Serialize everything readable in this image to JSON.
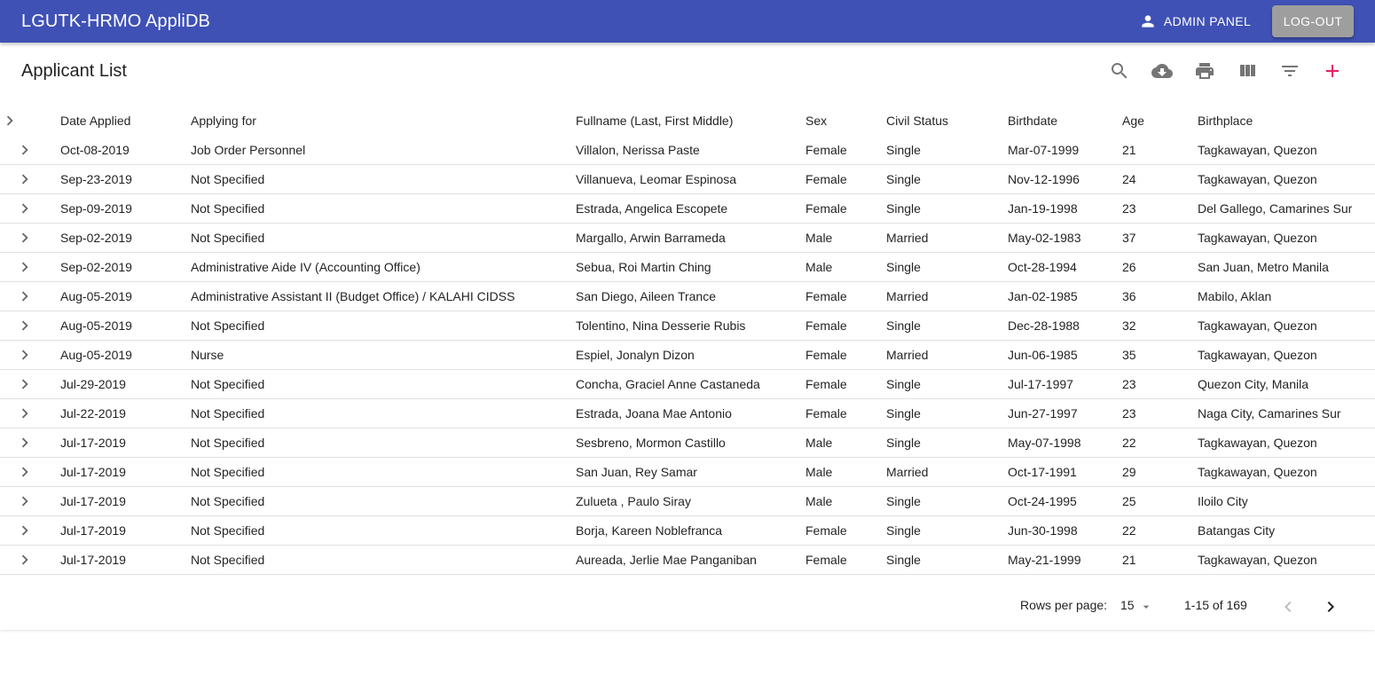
{
  "appbar": {
    "title": "LGUTK-HRMO AppliDB",
    "admin_label": "ADMIN PANEL",
    "logout_label": "LOG-OUT",
    "color": "#3f51b5"
  },
  "list": {
    "title": "Applicant List",
    "toolbar_icons": [
      "search-icon",
      "cloud-download-icon",
      "print-icon",
      "view-column-icon",
      "filter-list-icon",
      "add-icon"
    ],
    "add_color": "#e91e63"
  },
  "table": {
    "columns": [
      "Date Applied",
      "Applying for",
      "Fullname (Last, First Middle)",
      "Sex",
      "Civil Status",
      "Birthdate",
      "Age",
      "Birthplace"
    ],
    "rows": [
      [
        "Oct-08-2019",
        "Job Order Personnel",
        "Villalon, Nerissa Paste",
        "Female",
        "Single",
        "Mar-07-1999",
        "21",
        "Tagkawayan, Quezon"
      ],
      [
        "Sep-23-2019",
        "Not Specified",
        "Villanueva, Leomar Espinosa",
        "Female",
        "Single",
        "Nov-12-1996",
        "24",
        "Tagkawayan, Quezon"
      ],
      [
        "Sep-09-2019",
        "Not Specified",
        "Estrada, Angelica Escopete",
        "Female",
        "Single",
        "Jan-19-1998",
        "23",
        "Del Gallego, Camarines Sur"
      ],
      [
        "Sep-02-2019",
        "Not Specified",
        "Margallo, Arwin Barrameda",
        "Male",
        "Married",
        "May-02-1983",
        "37",
        "Tagkawayan, Quezon"
      ],
      [
        "Sep-02-2019",
        "Administrative Aide IV (Accounting Office)",
        "Sebua, Roi Martin Ching",
        "Male",
        "Single",
        "Oct-28-1994",
        "26",
        "San Juan, Metro Manila"
      ],
      [
        "Aug-05-2019",
        "Administrative Assistant II (Budget Office) / KALAHI CIDSS",
        "San Diego, Aileen Trance",
        "Female",
        "Married",
        "Jan-02-1985",
        "36",
        "Mabilo, Aklan"
      ],
      [
        "Aug-05-2019",
        "Not Specified",
        "Tolentino, Nina Desserie Rubis",
        "Female",
        "Single",
        "Dec-28-1988",
        "32",
        "Tagkawayan, Quezon"
      ],
      [
        "Aug-05-2019",
        "Nurse",
        "Espiel, Jonalyn Dizon",
        "Female",
        "Married",
        "Jun-06-1985",
        "35",
        "Tagkawayan, Quezon"
      ],
      [
        "Jul-29-2019",
        "Not Specified",
        "Concha, Graciel Anne Castaneda",
        "Female",
        "Single",
        "Jul-17-1997",
        "23",
        "Quezon City, Manila"
      ],
      [
        "Jul-22-2019",
        "Not Specified",
        "Estrada, Joana Mae Antonio",
        "Female",
        "Single",
        "Jun-27-1997",
        "23",
        "Naga City, Camarines Sur"
      ],
      [
        "Jul-17-2019",
        "Not Specified",
        "Sesbreno, Mormon Castillo",
        "Male",
        "Single",
        "May-07-1998",
        "22",
        "Tagkawayan, Quezon"
      ],
      [
        "Jul-17-2019",
        "Not Specified",
        "San Juan, Rey Samar",
        "Male",
        "Married",
        "Oct-17-1991",
        "29",
        "Tagkawayan, Quezon"
      ],
      [
        "Jul-17-2019",
        "Not Specified",
        "Zulueta , Paulo Siray",
        "Male",
        "Single",
        "Oct-24-1995",
        "25",
        "Iloilo City"
      ],
      [
        "Jul-17-2019",
        "Not Specified",
        "Borja, Kareen Noblefranca",
        "Female",
        "Single",
        "Jun-30-1998",
        "22",
        "Batangas City"
      ],
      [
        "Jul-17-2019",
        "Not Specified",
        "Aureada, Jerlie Mae Panganiban",
        "Female",
        "Single",
        "May-21-1999",
        "21",
        "Tagkawayan, Quezon"
      ]
    ]
  },
  "pagination": {
    "rows_per_page_label": "Rows per page:",
    "rows_per_page": "15",
    "range": "1-15 of 169"
  }
}
